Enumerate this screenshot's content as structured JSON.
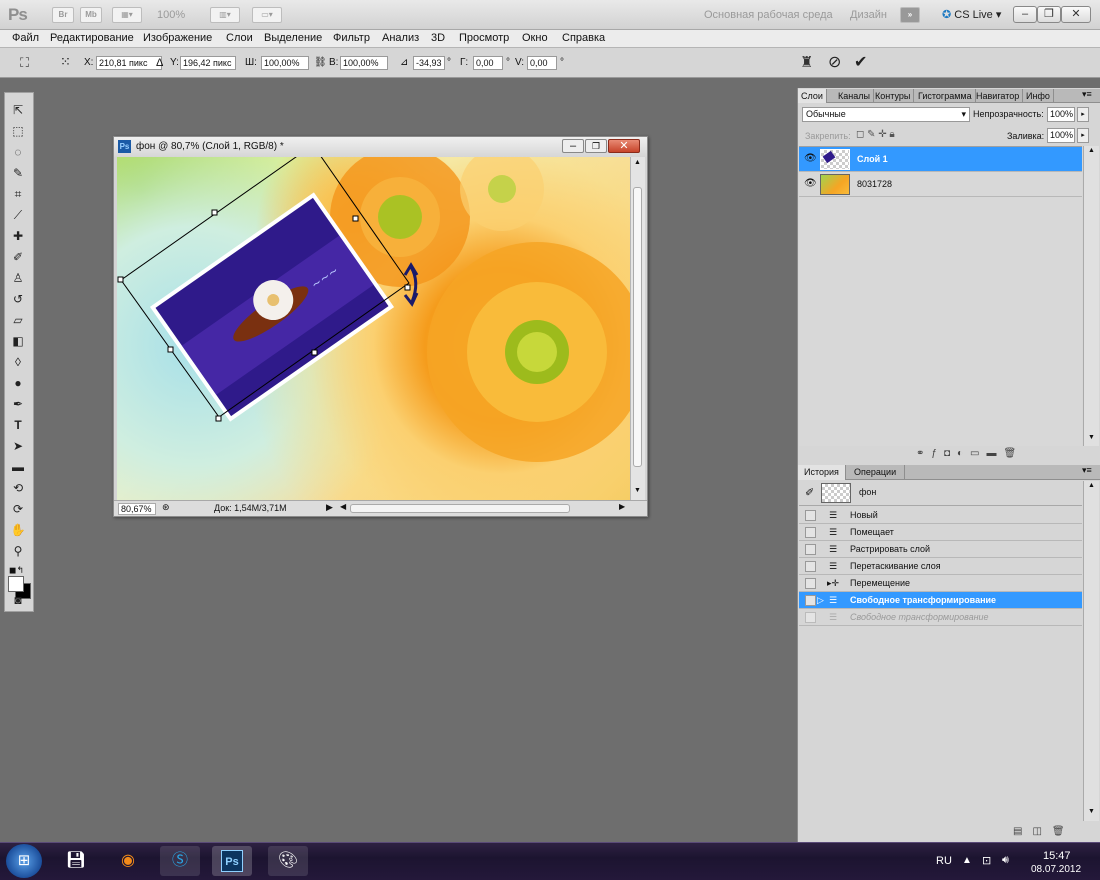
{
  "appbar": {
    "logo": "Ps",
    "bridge": "Br",
    "minibridge": "Mb",
    "zoom": "100%",
    "workspace": "Основная рабочая среда",
    "design": "Дизайн",
    "cslive": "CS Live"
  },
  "menu": [
    "Файл",
    "Редактирование",
    "Изображение",
    "Слои",
    "Выделение",
    "Фильтр",
    "Анализ",
    "3D",
    "Просмотр",
    "Окно",
    "Справка"
  ],
  "options": {
    "x_label": "X:",
    "x_value": "210,81 пикс",
    "y_label": "Y:",
    "y_value": "196,42 пикс",
    "w_label": "Ш:",
    "w_value": "100,00%",
    "h_label": "В:",
    "h_value": "100,00%",
    "angle_value": "-34,93",
    "deg": "°",
    "hskew_label": "Г:",
    "hskew_value": "0,00",
    "vskew_label": "V:",
    "vskew_value": "0,00"
  },
  "document": {
    "title": "фон @ 80,7% (Слой 1, RGB/8) *",
    "zoom": "80,67%",
    "doc_info": "Док: 1,54M/3,71M"
  },
  "layers_panel": {
    "tabs": [
      "Слои",
      "Каналы",
      "Контуры",
      "Гистограмма",
      "Навигатор",
      "Инфо"
    ],
    "blend_mode": "Обычные",
    "opacity_label": "Непрозрачность:",
    "opacity_value": "100%",
    "lock_label": "Закрепить:",
    "fill_label": "Заливка:",
    "fill_value": "100%",
    "layers": [
      {
        "name": "Слой 1",
        "selected": true
      },
      {
        "name": "8031728",
        "selected": false
      }
    ]
  },
  "history_panel": {
    "tabs": [
      "История",
      "Операции"
    ],
    "snapshot": "фон",
    "items": [
      {
        "label": "Новый",
        "state": "normal"
      },
      {
        "label": "Помещает",
        "state": "normal"
      },
      {
        "label": "Растрировать слой",
        "state": "normal"
      },
      {
        "label": "Перетаскивание слоя",
        "state": "normal"
      },
      {
        "label": "Перемещение",
        "state": "normal"
      },
      {
        "label": "Свободное трансформирование",
        "state": "selected"
      },
      {
        "label": "Свободное трансформирование",
        "state": "undone"
      }
    ]
  },
  "taskbar": {
    "lang": "RU",
    "time": "15:47",
    "date": "08.07.2012"
  },
  "colors": {
    "selection": "#3399ff",
    "workspace": "#6e6e6e",
    "taskbar": "#1c1430"
  }
}
